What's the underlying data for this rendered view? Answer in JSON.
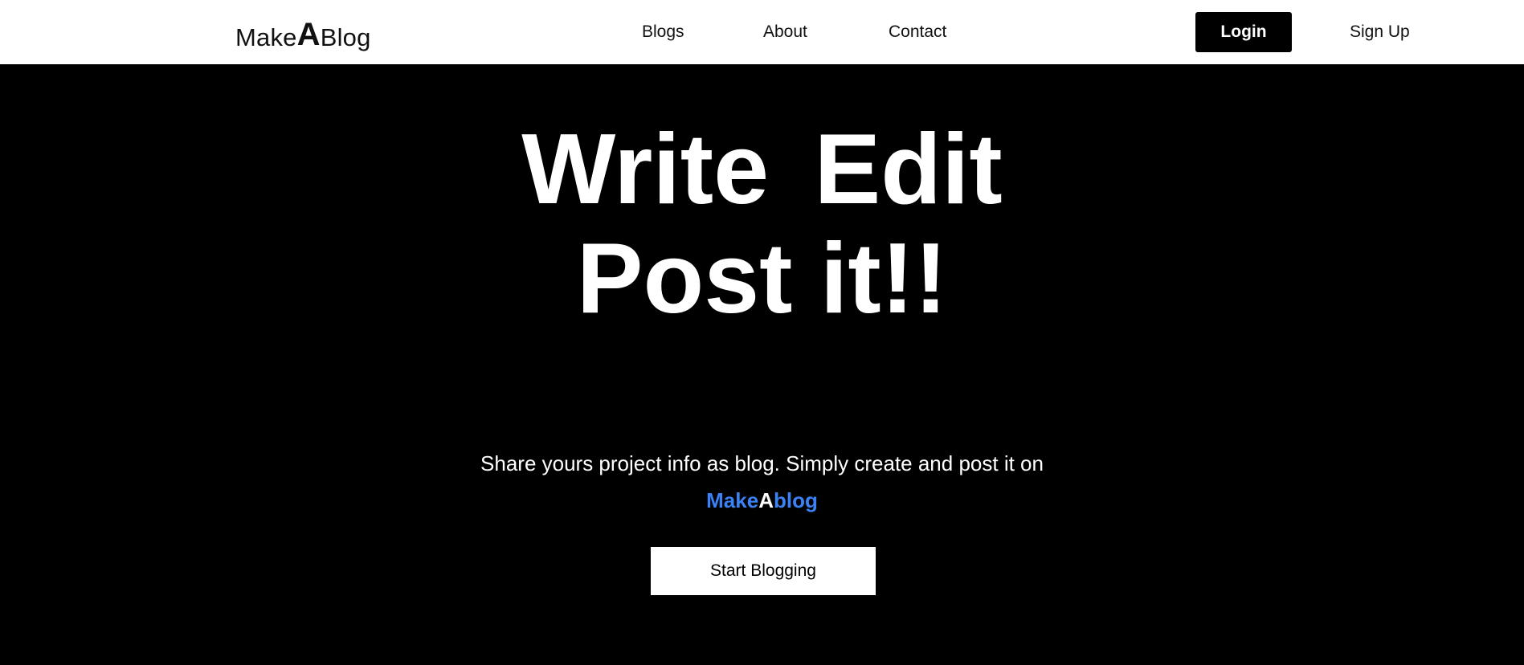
{
  "nav": {
    "logo_prefix": "Make",
    "logo_big": "A",
    "logo_suffix": "Blog",
    "links": [
      "Blogs",
      "About",
      "Contact"
    ],
    "login_label": "Login",
    "signup_label": "Sign Up"
  },
  "hero": {
    "headline_line1": "Write Edit",
    "headline_line2": "Post it!!",
    "subtitle": "Share yours project info as blog. Simply create and post it on",
    "brand_prefix": "Make",
    "brand_middle": "A",
    "brand_suffix": "blog",
    "cta_label": "Start Blogging"
  },
  "colors": {
    "nav_background": "#ffffff",
    "hero_background": "#000000",
    "brand_accent": "#3b82f6",
    "primary_button": "#000000",
    "cta_button": "#ffffff"
  }
}
